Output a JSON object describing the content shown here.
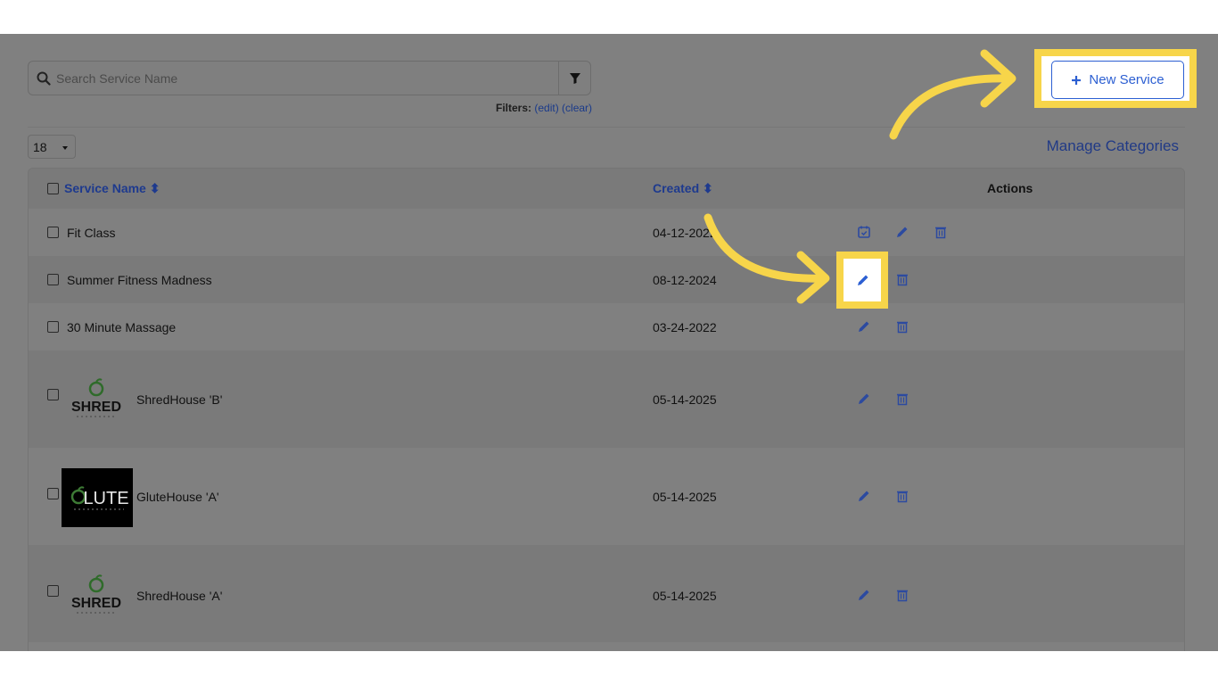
{
  "search": {
    "placeholder": "Search Service Name",
    "value": ""
  },
  "filters": {
    "label": "Filters:",
    "edit": "(edit)",
    "clear": "(clear)"
  },
  "page_size": "18",
  "manage_categories": "Manage Categories",
  "new_service": {
    "label": "New Service"
  },
  "table": {
    "headers": {
      "service_name": "Service Name",
      "created": "Created",
      "actions": "Actions"
    },
    "rows": [
      {
        "name": "Fit Class",
        "created": "04-12-2022"
      },
      {
        "name": "Summer Fitness Madness",
        "created": "08-12-2024"
      },
      {
        "name": "30 Minute Massage",
        "created": "03-24-2022"
      },
      {
        "name": "ShredHouse 'B'",
        "created": "05-14-2025",
        "logo": "SHRED"
      },
      {
        "name": "GluteHouse 'A'",
        "created": "05-14-2025",
        "logo": "LUTE"
      },
      {
        "name": "ShredHouse 'A'",
        "created": "05-14-2025",
        "logo": "SHRED"
      }
    ]
  },
  "icons": {
    "search": "search-icon",
    "filter": "filter-icon",
    "calendar": "calendar-check-icon",
    "edit": "pencil-icon",
    "delete": "trash-icon",
    "plus": "plus-icon"
  },
  "colors": {
    "highlight": "#f7d54a",
    "link": "#2c5fd2",
    "overlay": "#808080"
  }
}
